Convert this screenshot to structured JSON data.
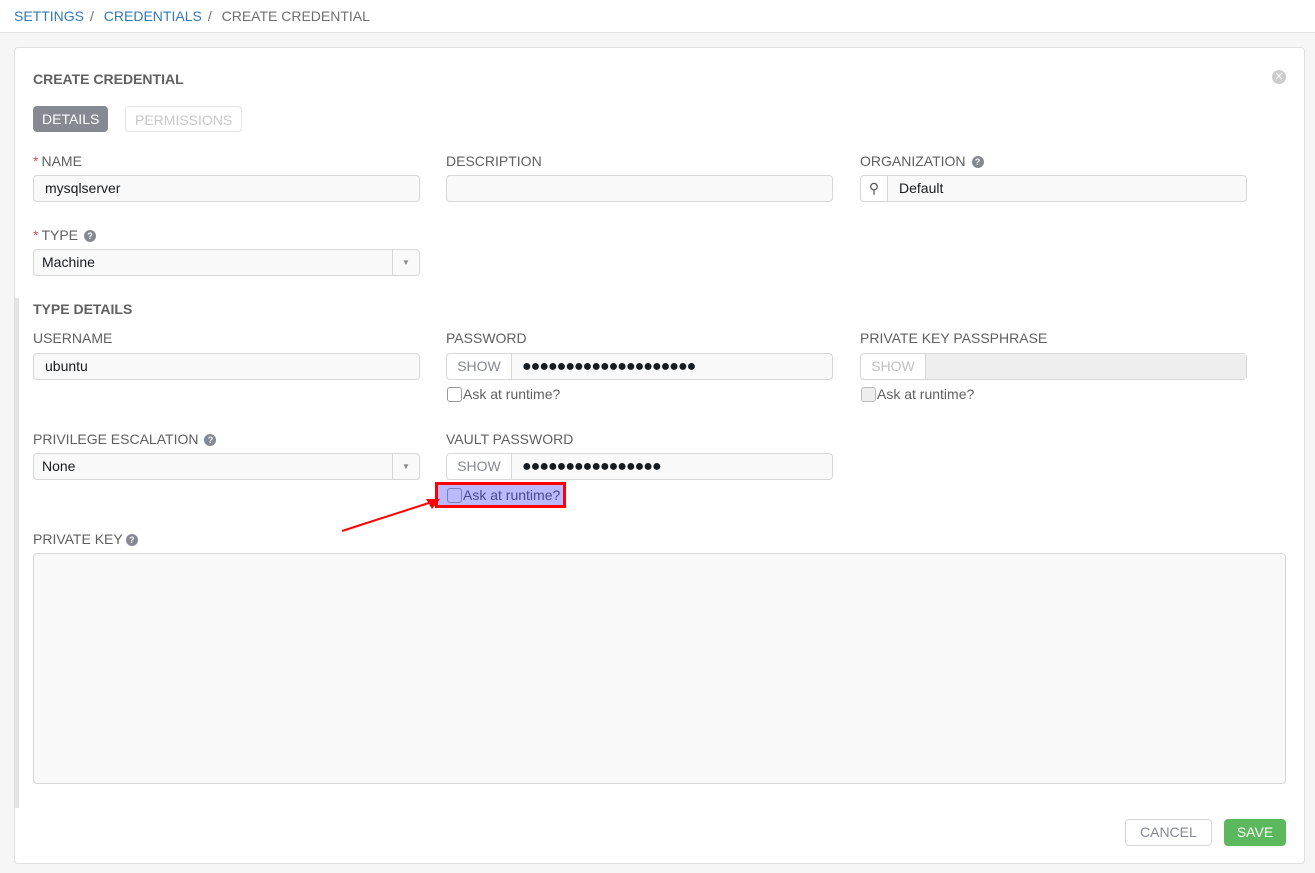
{
  "breadcrumb": {
    "items": [
      "SETTINGS",
      "CREDENTIALS",
      "CREATE CREDENTIAL"
    ]
  },
  "form": {
    "title": "CREATE CREDENTIAL",
    "tabs": [
      "DETAILS",
      "PERMISSIONS"
    ],
    "name": {
      "label": "NAME",
      "value": "mysqlserver"
    },
    "description": {
      "label": "DESCRIPTION",
      "value": ""
    },
    "organization": {
      "label": "ORGANIZATION",
      "value": "Default"
    },
    "type": {
      "label": "TYPE",
      "value": "Machine"
    },
    "type_details": "TYPE DETAILS",
    "username": {
      "label": "USERNAME",
      "value": "ubuntu"
    },
    "password": {
      "label": "PASSWORD",
      "show": "SHOW",
      "value": "●●●●●●●●●●●●●●●●●●●●",
      "ask": "Ask at runtime?"
    },
    "passphrase": {
      "label": "PRIVATE KEY PASSPHRASE",
      "show": "SHOW",
      "ask": "Ask at runtime?"
    },
    "privilege": {
      "label": "PRIVILEGE ESCALATION",
      "value": "None"
    },
    "vault": {
      "label": "VAULT PASSWORD",
      "show": "SHOW",
      "value": "●●●●●●●●●●●●●●●●",
      "ask": "Ask at runtime?"
    },
    "private_key": {
      "label": "PRIVATE KEY"
    },
    "cancel": "CANCEL",
    "save": "SAVE"
  }
}
